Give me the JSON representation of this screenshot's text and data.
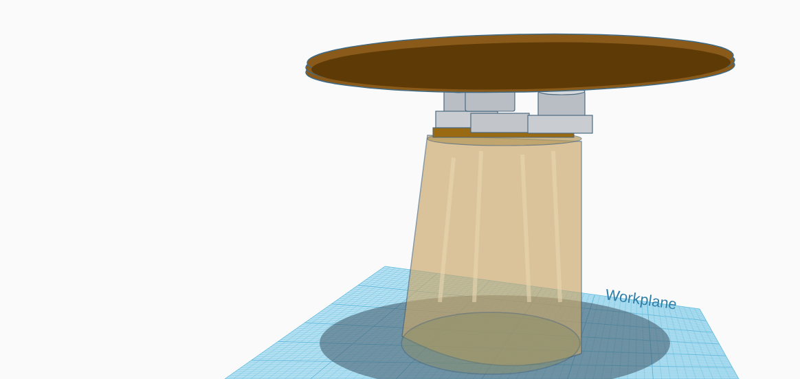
{
  "scene": {
    "workplane_label": "Workplane"
  }
}
